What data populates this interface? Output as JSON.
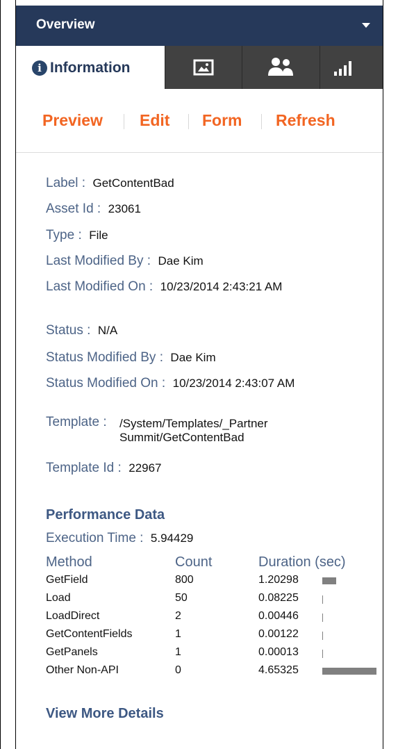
{
  "header": {
    "title": "Overview"
  },
  "tabs": [
    {
      "label": "Information",
      "icon": "info-icon",
      "active": true
    },
    {
      "label": "",
      "icon": "image-icon"
    },
    {
      "label": "",
      "icon": "users-icon"
    },
    {
      "label": "",
      "icon": "bar-chart-icon"
    }
  ],
  "actions": [
    "Preview",
    "Edit",
    "Form",
    "Refresh"
  ],
  "info": [
    {
      "label": "Label :",
      "value": "GetContentBad"
    },
    {
      "label": "Asset Id :",
      "value": "23061"
    },
    {
      "label": "Type :",
      "value": "File"
    },
    {
      "label": "Last Modified By :",
      "value": "Dae Kim"
    },
    {
      "label": "Last Modified On :",
      "value": "10/23/2014 2:43:21 AM"
    }
  ],
  "status": [
    {
      "label": "Status :",
      "value": "N/A"
    },
    {
      "label": "Status Modified By :",
      "value": "Dae Kim"
    },
    {
      "label": "Status Modified On :",
      "value": "10/23/2014 2:43:07 AM"
    }
  ],
  "template": {
    "label": "Template :",
    "value_line1": "/System/Templates/_Partner",
    "value_line2": "Summit/GetContentBad",
    "id_label": "Template Id :",
    "id_value": "22967"
  },
  "performance": {
    "title": "Performance Data",
    "exec_label": "Execution Time :",
    "exec_value": "5.94429",
    "columns": [
      "Method",
      "Count",
      "Duration (sec)"
    ],
    "rows": [
      {
        "method": "GetField",
        "count": "800",
        "duration": "1.20298",
        "duration_num": 1.20298
      },
      {
        "method": "Load",
        "count": "50",
        "duration": "0.08225",
        "duration_num": 0.08225
      },
      {
        "method": "LoadDirect",
        "count": "2",
        "duration": "0.00446",
        "duration_num": 0.00446
      },
      {
        "method": "GetContentFields",
        "count": "1",
        "duration": "0.00122",
        "duration_num": 0.00122
      },
      {
        "method": "GetPanels",
        "count": "1",
        "duration": "0.00013",
        "duration_num": 0.00013
      },
      {
        "method": "Other Non-API",
        "count": "0",
        "duration": "4.65325",
        "duration_num": 4.65325
      }
    ],
    "bar_color": "#808080"
  },
  "more_link": "View More Details",
  "colors": {
    "header_bg": "#26395a",
    "tabbar_bg": "#414141",
    "action": "#f26522",
    "label": "#4d6487"
  }
}
